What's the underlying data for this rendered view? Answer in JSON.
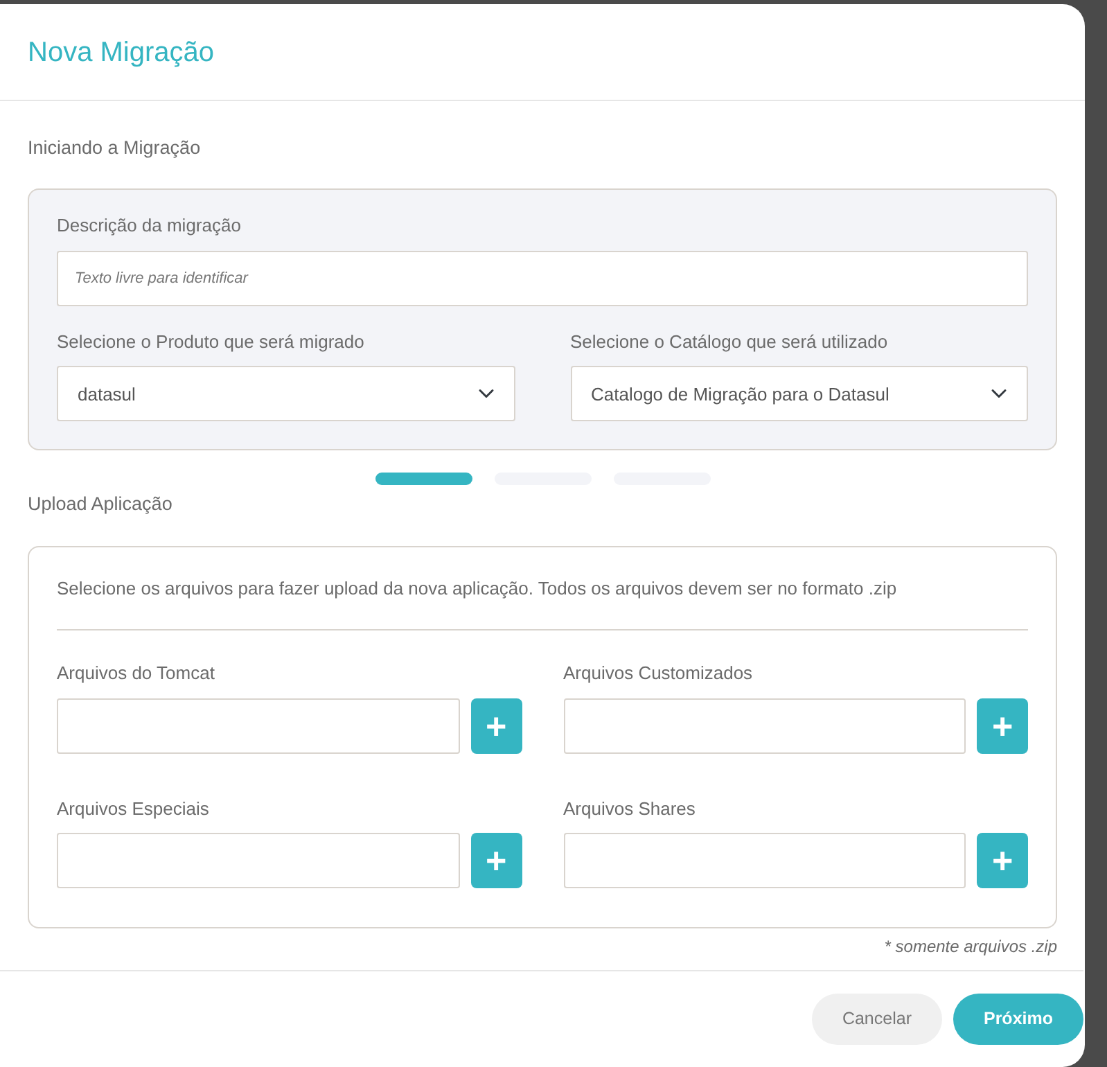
{
  "modal": {
    "title": "Nova Migração"
  },
  "section_start": {
    "heading": "Iniciando a Migração",
    "description": {
      "label": "Descrição da migração",
      "placeholder": "Texto livre para identificar"
    },
    "selects": [
      {
        "label": "Selecione o Produto que será migrado",
        "value": "datasul"
      },
      {
        "label": "Selecione o Catálogo que será utilizado",
        "value": "Catalogo de Migração para o Datasul"
      }
    ]
  },
  "steps": [
    {
      "selected": true
    },
    {
      "selected": false
    },
    {
      "selected": false
    }
  ],
  "section_upload": {
    "heading": "Upload Aplicação",
    "intro": "Selecione os arquivos para fazer upload da nova aplicação. Todos os arquivos devem ser no formato .zip",
    "files": [
      {
        "label": "Arquivos do Tomcat",
        "button": "+"
      },
      {
        "label": "Arquivos Customizados",
        "button": "+"
      },
      {
        "label": "Arquivos Especiais",
        "button": "+"
      },
      {
        "label": "Arquivos Shares",
        "button": "+"
      }
    ],
    "note": "* somente arquivos .zip"
  },
  "buttons": [
    {
      "label": "Cancelar",
      "kind": "secondary"
    },
    {
      "label": "Próximo",
      "kind": "primary"
    }
  ]
}
